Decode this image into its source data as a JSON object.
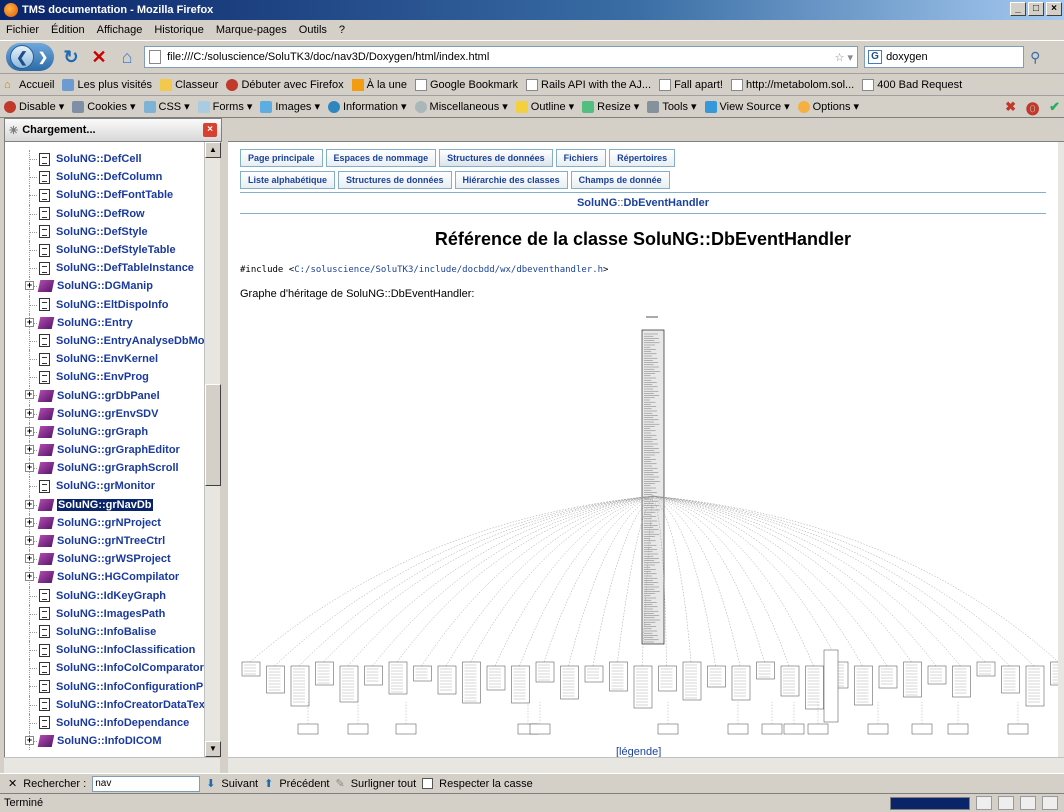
{
  "window": {
    "title": "TMS documentation - Mozilla Firefox"
  },
  "menu": [
    "Fichier",
    "Édition",
    "Affichage",
    "Historique",
    "Marque-pages",
    "Outils",
    "?"
  ],
  "navbar": {
    "url": "file:///C:/soluscience/SoluTK3/doc/nav3D/Doxygen/html/index.html",
    "search_value": "doxygen"
  },
  "bookmarks": [
    "Accueil",
    "Les plus visités",
    "Classeur",
    "Débuter avec Firefox",
    "À la une",
    "Google Bookmark",
    "Rails API with the AJ...",
    "Fall apart!",
    "http://metabolom.sol...",
    "400 Bad Request"
  ],
  "devtools": [
    "Disable",
    "Cookies",
    "CSS",
    "Forms",
    "Images",
    "Information",
    "Miscellaneous",
    "Outline",
    "Resize",
    "Tools",
    "View Source",
    "Options"
  ],
  "sidebar": {
    "tab_label": "Chargement...",
    "items": [
      {
        "label": "SoluNG::DefCell",
        "icon": "doc"
      },
      {
        "label": "SoluNG::DefColumn",
        "icon": "doc"
      },
      {
        "label": "SoluNG::DefFontTable",
        "icon": "doc"
      },
      {
        "label": "SoluNG::DefRow",
        "icon": "doc"
      },
      {
        "label": "SoluNG::DefStyle",
        "icon": "doc"
      },
      {
        "label": "SoluNG::DefStyleTable",
        "icon": "doc"
      },
      {
        "label": "SoluNG::DefTableInstance",
        "icon": "doc"
      },
      {
        "label": "SoluNG::DGManip",
        "icon": "book"
      },
      {
        "label": "SoluNG::EltDispoInfo",
        "icon": "doc"
      },
      {
        "label": "SoluNG::Entry",
        "icon": "book"
      },
      {
        "label": "SoluNG::EntryAnalyseDbModel",
        "icon": "doc"
      },
      {
        "label": "SoluNG::EnvKernel",
        "icon": "doc"
      },
      {
        "label": "SoluNG::EnvProg",
        "icon": "doc"
      },
      {
        "label": "SoluNG::grDbPanel",
        "icon": "book"
      },
      {
        "label": "SoluNG::grEnvSDV",
        "icon": "book"
      },
      {
        "label": "SoluNG::grGraph",
        "icon": "book"
      },
      {
        "label": "SoluNG::grGraphEditor",
        "icon": "book"
      },
      {
        "label": "SoluNG::grGraphScroll",
        "icon": "book"
      },
      {
        "label": "SoluNG::grMonitor",
        "icon": "doc"
      },
      {
        "label": "SoluNG::grNavDb",
        "icon": "book",
        "selected": true
      },
      {
        "label": "SoluNG::grNProject",
        "icon": "book"
      },
      {
        "label": "SoluNG::grNTreeCtrl",
        "icon": "book"
      },
      {
        "label": "SoluNG::grWSProject",
        "icon": "book"
      },
      {
        "label": "SoluNG::HGCompilator",
        "icon": "book"
      },
      {
        "label": "SoluNG::IdKeyGraph",
        "icon": "doc"
      },
      {
        "label": "SoluNG::ImagesPath",
        "icon": "doc"
      },
      {
        "label": "SoluNG::InfoBalise",
        "icon": "doc"
      },
      {
        "label": "SoluNG::InfoClassification",
        "icon": "doc"
      },
      {
        "label": "SoluNG::InfoColComparator",
        "icon": "doc"
      },
      {
        "label": "SoluNG::InfoConfigurationPipe",
        "icon": "doc"
      },
      {
        "label": "SoluNG::InfoCreatorDataText",
        "icon": "doc"
      },
      {
        "label": "SoluNG::InfoDependance",
        "icon": "doc"
      },
      {
        "label": "SoluNG::InfoDICOM",
        "icon": "book"
      }
    ]
  },
  "content": {
    "tabs_main": [
      "Page principale",
      "Espaces de nommage",
      "Structures de données",
      "Fichiers",
      "Répertoires"
    ],
    "tabs_main_active": 2,
    "tabs_sub": [
      "Liste alphabétique",
      "Structures de données",
      "Hiérarchie des classes",
      "Champs de donnée"
    ],
    "nav_path_ns": "SoluNG",
    "nav_path_sep": "::",
    "nav_path_class": "DbEventHandler",
    "heading": "Référence de la classe SoluNG::DbEventHandler",
    "include_prefix": "#include <",
    "include_path": "C:/soluscience/SoluTK3/include/docbdd/wx/dbeventhandler.h",
    "include_suffix": ">",
    "graph_label": "Graphe d'héritage de SoluNG::DbEventHandler:",
    "legend": "[légende]"
  },
  "findbar": {
    "label": "Rechercher :",
    "value": "nav",
    "next": "Suivant",
    "prev": "Précédent",
    "highlight": "Surligner tout",
    "match_case": "Respecter la casse"
  },
  "status": {
    "text": "Terminé"
  }
}
